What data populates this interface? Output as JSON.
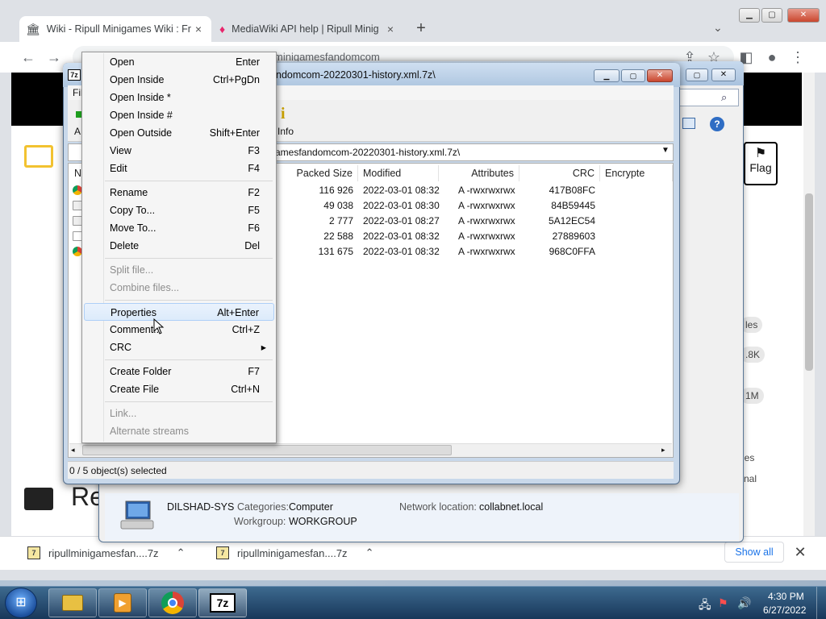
{
  "browser": {
    "tabs": [
      {
        "title": "Wiki - Ripull Minigames Wiki : Fr",
        "close": "×"
      },
      {
        "title": "MediaWiki API help | Ripull Minig",
        "close": "×"
      }
    ],
    "new_tab": "+",
    "address": "minigamesfandomcom",
    "downloads": [
      {
        "name": "ripullminigamesfan....7z"
      },
      {
        "name": "ripullminigamesfan....7z"
      }
    ],
    "show_all": "Show all",
    "flag_label": "Flag",
    "page_heading_fragment": "Re",
    "side_labels": [
      "les",
      ".8K",
      "1M",
      "les",
      "nal"
    ]
  },
  "explorer": {
    "computer_name": "DILSHAD-SYS",
    "categories_label": "Categories:",
    "categories_value": "Computer",
    "workgroup_label": "Workgroup:",
    "workgroup_value": "WORKGROUP",
    "network_label": "Network location:",
    "network_value": "collabnet.local"
  },
  "sevenzip": {
    "title": "ndomcom-20220301-history.xml.7z\\",
    "menu_fragment": "Fil",
    "toolbar_fragment": "A",
    "info_label": "Info",
    "path": "amesfandomcom-20220301-history.xml.7z\\",
    "name_col_fragment": "N",
    "columns": [
      "Packed Size",
      "Modified",
      "Attributes",
      "CRC",
      "Encrypte"
    ],
    "rows": [
      {
        "packed": "116 926",
        "modified": "2022-03-01 08:32",
        "attr": "A -rwxrwxrwx",
        "crc": "417B08FC"
      },
      {
        "packed": "49 038",
        "modified": "2022-03-01 08:30",
        "attr": "A -rwxrwxrwx",
        "crc": "84B59445"
      },
      {
        "packed": "2 777",
        "modified": "2022-03-01 08:27",
        "attr": "A -rwxrwxrwx",
        "crc": "5A12EC54"
      },
      {
        "packed": "22 588",
        "modified": "2022-03-01 08:32",
        "attr": "A -rwxrwxrwx",
        "crc": "27889603"
      },
      {
        "packed": "131 675",
        "modified": "2022-03-01 08:32",
        "attr": "A -rwxrwxrwx",
        "crc": "968C0FFA"
      }
    ],
    "status": "0 / 5 object(s) selected"
  },
  "context_menu": [
    {
      "label": "Open",
      "shortcut": "Enter"
    },
    {
      "label": "Open Inside",
      "shortcut": "Ctrl+PgDn"
    },
    {
      "label": "Open Inside *",
      "shortcut": ""
    },
    {
      "label": "Open Inside #",
      "shortcut": ""
    },
    {
      "label": "Open Outside",
      "shortcut": "Shift+Enter"
    },
    {
      "label": "View",
      "shortcut": "F3"
    },
    {
      "label": "Edit",
      "shortcut": "F4"
    },
    {
      "label": "Rename",
      "shortcut": "F2"
    },
    {
      "label": "Copy To...",
      "shortcut": "F5"
    },
    {
      "label": "Move To...",
      "shortcut": "F6"
    },
    {
      "label": "Delete",
      "shortcut": "Del"
    },
    {
      "label": "Split file...",
      "shortcut": ""
    },
    {
      "label": "Combine files...",
      "shortcut": ""
    },
    {
      "label": "Properties",
      "shortcut": "Alt+Enter"
    },
    {
      "label": "Comment...",
      "shortcut": "Ctrl+Z"
    },
    {
      "label": "CRC",
      "shortcut": "▸"
    },
    {
      "label": "Create Folder",
      "shortcut": "F7"
    },
    {
      "label": "Create File",
      "shortcut": "Ctrl+N"
    },
    {
      "label": "Link...",
      "shortcut": ""
    },
    {
      "label": "Alternate streams",
      "shortcut": ""
    }
  ],
  "taskbar": {
    "time": "4:30 PM",
    "date": "6/27/2022",
    "sevenzip_label": "7z"
  }
}
